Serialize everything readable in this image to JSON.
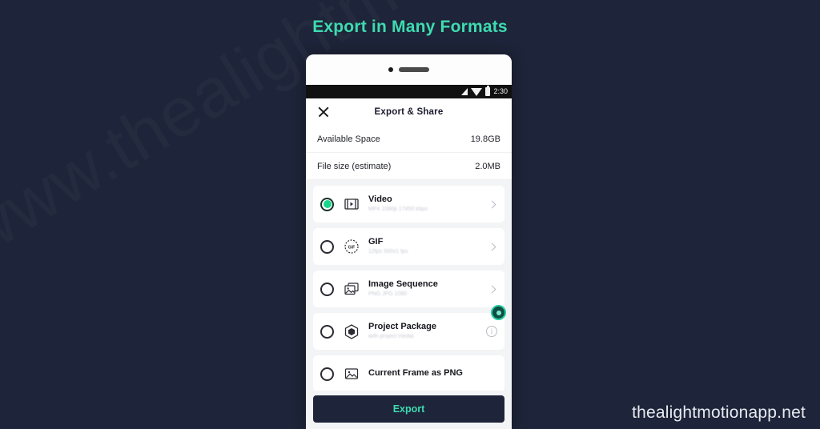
{
  "page": {
    "headline": "Export in Many Formats",
    "corner_watermark": "thealightmotionapp.net",
    "background_watermark": "www.thealightmotionapp.net",
    "background_color": "#1e2439",
    "accent_color": "#3ddcb0"
  },
  "phone": {
    "statusbar": {
      "time": "2:30",
      "icons": [
        "signal-icon",
        "wifi-icon",
        "battery-icon"
      ]
    },
    "header": {
      "close_label": "",
      "title": "Export & Share"
    },
    "info_rows": [
      {
        "label": "Available Space",
        "value": "19.8GB"
      },
      {
        "label": "File size (estimate)",
        "value": "2.0MB"
      }
    ],
    "formats": [
      {
        "title": "Video",
        "subtitle": "MP4 1080p 17450 kbps",
        "icon": "video-film-icon",
        "selected": true,
        "has_chevron": true,
        "has_info": false
      },
      {
        "title": "GIF",
        "subtitle": "12fps 500x1 fps",
        "icon": "gif-icon",
        "selected": false,
        "has_chevron": true,
        "has_info": false
      },
      {
        "title": "Image Sequence",
        "subtitle": "PNG JPG 1080",
        "icon": "image-stack-icon",
        "selected": false,
        "has_chevron": true,
        "has_info": false
      },
      {
        "title": "Project Package",
        "subtitle": "with project media",
        "icon": "package-hexagon-icon",
        "selected": false,
        "has_chevron": false,
        "has_info": true
      },
      {
        "title": "Current Frame as PNG",
        "subtitle": "",
        "icon": "picture-icon",
        "selected": false,
        "has_chevron": false,
        "has_info": false
      }
    ],
    "export_button": "Export",
    "info_icon_glyph": "i"
  }
}
